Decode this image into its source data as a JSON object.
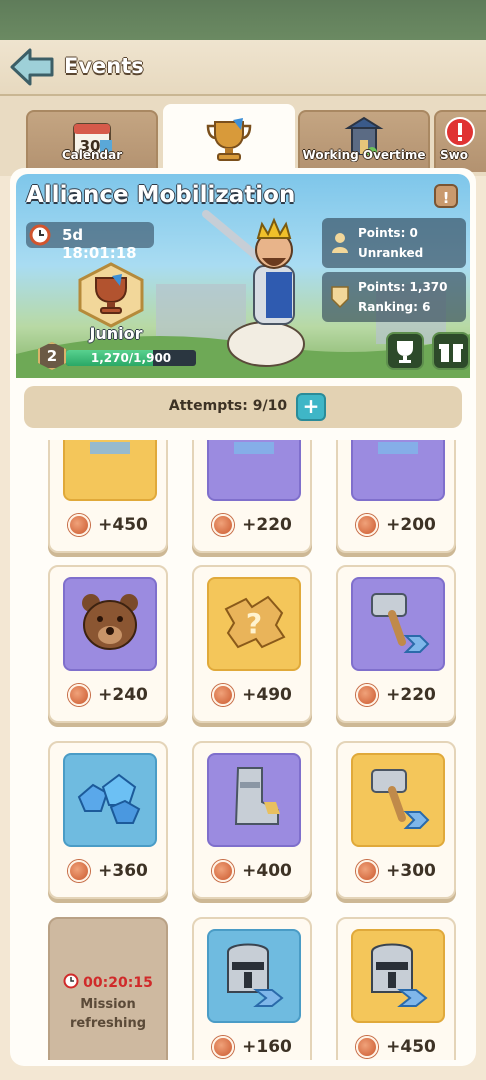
{
  "header": {
    "title": "Events"
  },
  "tabs": [
    {
      "label": "Calendar",
      "icon": "calendar-icon",
      "badge": "30"
    },
    {
      "label": "",
      "icon": "trophy-icon",
      "active": true
    },
    {
      "label": "Working Overtime",
      "icon": "tower-icon"
    },
    {
      "label": "Swo",
      "icon": "alert-icon"
    }
  ],
  "event": {
    "title": "Alliance Mobilization",
    "timer": "5d 18:01:18",
    "rank_name": "Junior",
    "level": "2",
    "progress_text": "1,270/1,900",
    "progress_fraction": 0.668,
    "personal": {
      "points_label": "Points: 0",
      "rank_label": "Unranked"
    },
    "alliance": {
      "points_label": "Points: 1,370",
      "rank_label": "Ranking: 6"
    }
  },
  "attempts": {
    "label": "Attempts: 9/10",
    "plus": "+"
  },
  "missions": [
    {
      "art": "gold",
      "icon": "partial-item-icon",
      "reward": "+450"
    },
    {
      "art": "purple",
      "icon": "partial-item-icon",
      "reward": "+220"
    },
    {
      "art": "purple",
      "icon": "partial-item-icon",
      "reward": "+200"
    },
    {
      "art": "purple",
      "icon": "bear-icon",
      "reward": "+240"
    },
    {
      "art": "gold",
      "icon": "mystery-puzzle-icon",
      "reward": "+490"
    },
    {
      "art": "purple",
      "icon": "hammer-upgrade-icon",
      "reward": "+220"
    },
    {
      "art": "blue",
      "icon": "gems-icon",
      "reward": "+360"
    },
    {
      "art": "purple",
      "icon": "armor-boot-icon",
      "reward": "+400"
    },
    {
      "art": "gold",
      "icon": "hammer-upgrade-icon",
      "reward": "+300"
    },
    {
      "refresh": true,
      "timer": "00:20:15",
      "label_line1": "Mission",
      "label_line2": "refreshing"
    },
    {
      "art": "blue",
      "icon": "helmet-upgrade-icon",
      "reward": "+160"
    },
    {
      "art": "gold",
      "icon": "helmet-upgrade-icon",
      "reward": "+450"
    }
  ],
  "colors": {
    "accent": "#3fb6c7",
    "progress": "#2aa866",
    "refresh_timer": "#d02a2a"
  }
}
